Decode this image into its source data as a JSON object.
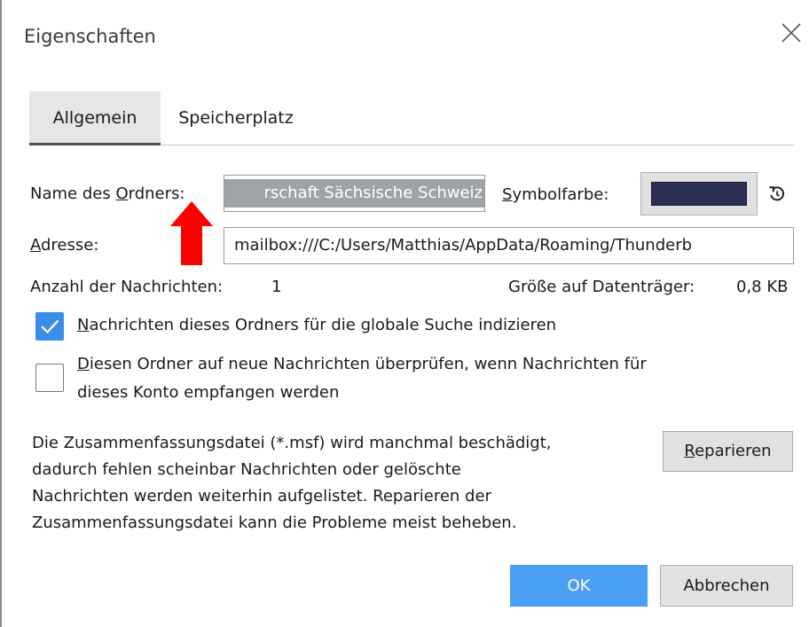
{
  "window": {
    "title": "Eigenschaften",
    "close_icon": "close-icon"
  },
  "tabs": [
    {
      "label": "Allgemein",
      "active": true
    },
    {
      "label": "Speicherplatz",
      "active": false
    }
  ],
  "folder_name": {
    "label_pre": "Name des ",
    "label_ul": "O",
    "label_post": "rdners:",
    "value": "rschaft Sächsische Schweiz"
  },
  "symbol_color": {
    "label_ul": "S",
    "label_post": "ymbolfarbe:",
    "color": "#2b2f52",
    "reset_icon": "reset-color-icon"
  },
  "address": {
    "label_ul": "A",
    "label_post": "dresse:",
    "value": "mailbox:///C:/Users/Matthias/AppData/Roaming/Thunderb"
  },
  "stats": {
    "count_label": "Anzahl der Nachrichten:",
    "count_value": "1",
    "size_label": "Größe auf Datenträger:",
    "size_value": "0,8 KB"
  },
  "options": {
    "global_search": {
      "checked": true,
      "label_ul": "N",
      "label_post": "achrichten dieses Ordners für die globale Suche indizieren"
    },
    "check_new": {
      "checked": false,
      "label_ul": "D",
      "line1_post": "iesen Ordner auf neue Nachrichten überprüfen, wenn Nachrichten für",
      "line2": "dieses Konto empfangen werden"
    }
  },
  "repair": {
    "description_lines": [
      "Die Zusammenfassungsdatei (*.msf) wird manchmal beschädigt,",
      "dadurch fehlen scheinbar Nachrichten oder gelöschte",
      "Nachrichten werden weiterhin aufgelistet. Reparieren der",
      "Zusammenfassungsdatei kann die Probleme meist beheben."
    ],
    "button_ul": "R",
    "button_post": "eparieren"
  },
  "footer": {
    "ok_label": "OK",
    "cancel_label": "Abbrechen"
  },
  "colors": {
    "accent": "#4a9ef5",
    "checkbox": "#3b8ee8",
    "annotation_arrow": "#ff0000"
  }
}
